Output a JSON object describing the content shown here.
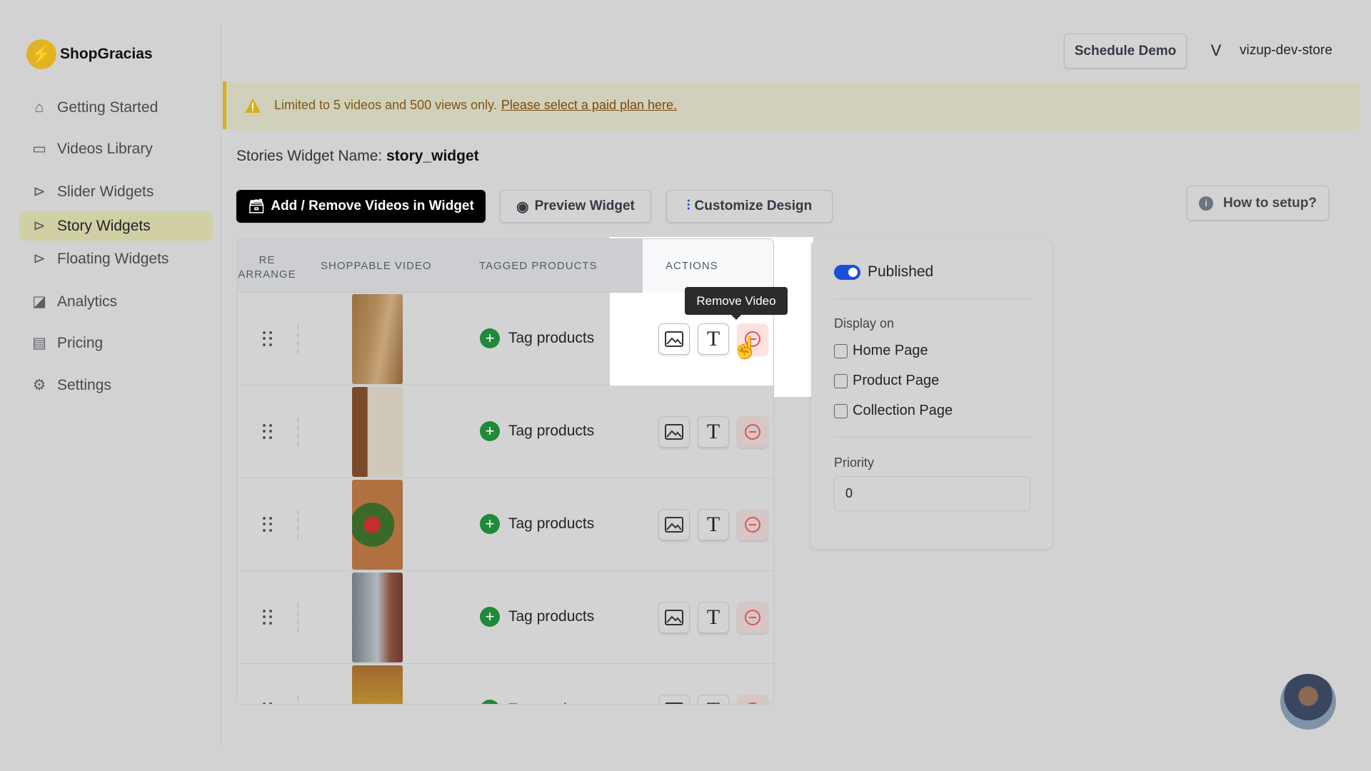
{
  "brand": {
    "name": "ShopGracias",
    "logo_icon": "lightning-bolt-icon"
  },
  "sidebar": {
    "items": [
      {
        "label": "Getting Started",
        "icon": "home-icon"
      },
      {
        "label": "Videos Library",
        "icon": "video-camera-icon"
      },
      {
        "label": "Slider Widgets",
        "icon": "play-circle-icon"
      },
      {
        "label": "Story Widgets",
        "icon": "play-circle-icon",
        "active": true
      },
      {
        "label": "Floating Widgets",
        "icon": "play-circle-icon"
      },
      {
        "label": "Analytics",
        "icon": "chart-icon"
      },
      {
        "label": "Pricing",
        "icon": "credit-card-icon"
      },
      {
        "label": "Settings",
        "icon": "gear-icon"
      }
    ]
  },
  "header": {
    "schedule_demo": "Schedule Demo",
    "avatar_initial": "V",
    "store": "vizup-dev-store"
  },
  "banner": {
    "text": "Limited to 5 videos and 500 views only.",
    "link": "Please select a paid plan here."
  },
  "widget": {
    "name_label": "Stories Widget Name:",
    "name": "story_widget"
  },
  "toolbar": {
    "add_remove": "Add / Remove Videos in Widget",
    "preview": "Preview Widget",
    "customize": "Customize Design",
    "how_to": "How to setup?"
  },
  "table": {
    "headers": {
      "rearrange_1": "RE",
      "rearrange_2": "ARRANGE",
      "video": "SHOPPABLE VIDEO",
      "tagged": "TAGGED PRODUCTS",
      "actions": "ACTIONS"
    },
    "tag_label": "Tag products",
    "rows": 5
  },
  "tooltip": "Remove Video",
  "panel": {
    "published": "Published",
    "published_on": true,
    "display_on": "Display on",
    "pages": [
      {
        "label": "Home Page",
        "checked": false
      },
      {
        "label": "Product Page",
        "checked": false
      },
      {
        "label": "Collection Page",
        "checked": false
      }
    ],
    "priority_label": "Priority",
    "priority_value": "0"
  },
  "colors": {
    "accent": "#1d4ed8",
    "primary_button": "#000000",
    "success": "#1e8a3a",
    "danger": "#e05252",
    "warning": "#dcae17"
  }
}
